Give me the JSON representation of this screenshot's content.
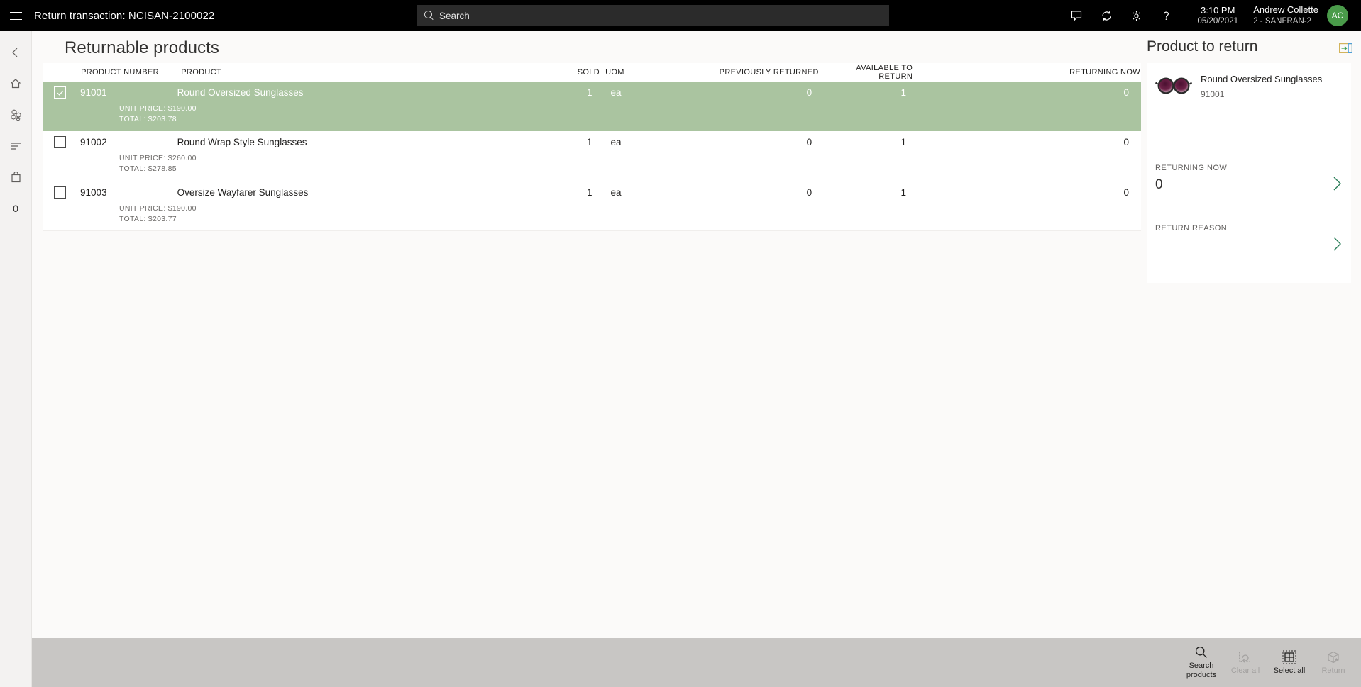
{
  "topbar": {
    "menu_icon": "hamburger-icon",
    "title": "Return transaction: NCISAN-2100022",
    "search": {
      "placeholder": "Search",
      "icon": "search-icon",
      "value": ""
    },
    "icons": [
      "feedback-icon",
      "sync-icon",
      "settings-gear-icon",
      "help-icon"
    ],
    "time": "3:10 PM",
    "date": "05/20/2021",
    "user_name": "Andrew Collette",
    "user_store": "2 - SANFRAN-2",
    "avatar_initials": "AC",
    "avatar_color": "#4a9b4a"
  },
  "rail": {
    "items": [
      {
        "name": "back-arrow-icon",
        "label": ""
      },
      {
        "name": "home-icon",
        "label": ""
      },
      {
        "name": "products-icon",
        "label": ""
      },
      {
        "name": "list-icon",
        "label": ""
      },
      {
        "name": "shopping-bag-icon",
        "label": ""
      },
      {
        "name": "cart-count",
        "label": "0"
      }
    ]
  },
  "main": {
    "page_title": "Returnable products",
    "columns": [
      "PRODUCT NUMBER",
      "PRODUCT",
      "SOLD",
      "UOM",
      "PREVIOUSLY RETURNED",
      "AVAILABLE TO RETURN",
      "RETURNING NOW"
    ],
    "rows": [
      {
        "selected": true,
        "checked": true,
        "product_number": "91001",
        "product": "Round Oversized Sunglasses",
        "sold": "1",
        "uom": "ea",
        "previously_returned": "0",
        "available_to_return": "1",
        "returning_now": "0",
        "unit_price": "UNIT PRICE: $190.00",
        "total": "TOTAL: $203.78"
      },
      {
        "selected": false,
        "checked": false,
        "product_number": "91002",
        "product": "Round Wrap Style Sunglasses",
        "sold": "1",
        "uom": "ea",
        "previously_returned": "0",
        "available_to_return": "1",
        "returning_now": "0",
        "unit_price": "UNIT PRICE: $260.00",
        "total": "TOTAL: $278.85"
      },
      {
        "selected": false,
        "checked": false,
        "product_number": "91003",
        "product": "Oversize Wayfarer Sunglasses",
        "sold": "1",
        "uom": "ea",
        "previously_returned": "0",
        "available_to_return": "1",
        "returning_now": "0",
        "unit_price": "UNIT PRICE: $190.00",
        "total": "TOTAL: $203.77"
      }
    ],
    "selected_row_color": "#aac4a0"
  },
  "right_panel": {
    "title": "Product to return",
    "expand_icon": "expand-panel-icon",
    "product": {
      "name": "Round Oversized Sunglasses",
      "number": "91001",
      "image": "sunglasses-thumbnail"
    },
    "fields": [
      {
        "label": "RETURNING NOW",
        "value": "0",
        "chevron": "chevron-right-icon"
      },
      {
        "label": "RETURN REASON",
        "value": "",
        "chevron": "chevron-right-icon"
      }
    ]
  },
  "bottombar": {
    "buttons": [
      {
        "label": "Search products",
        "icon": "search-icon",
        "disabled": false
      },
      {
        "label": "Clear all",
        "icon": "clear-icon",
        "disabled": true
      },
      {
        "label": "Select all",
        "icon": "select-all-icon",
        "disabled": false
      },
      {
        "label": "Return",
        "icon": "return-box-icon",
        "disabled": true
      }
    ]
  }
}
